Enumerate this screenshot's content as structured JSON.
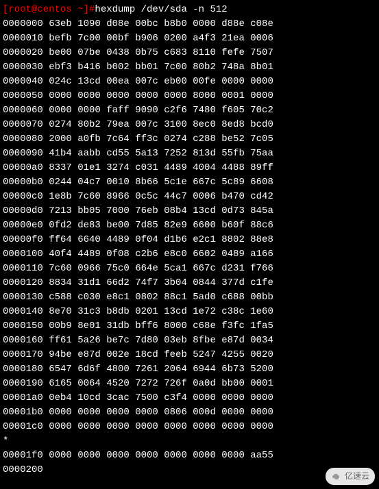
{
  "prompt": {
    "user_host": "[root@centos ~]#",
    "command": "hexdump /dev/sda -n 512"
  },
  "hexdump": {
    "lines": [
      {
        "offset": "0000000",
        "bytes": "63eb 1090 d08e 00bc b8b0 0000 d88e c08e"
      },
      {
        "offset": "0000010",
        "bytes": "befb 7c00 00bf b906 0200 a4f3 21ea 0006"
      },
      {
        "offset": "0000020",
        "bytes": "be00 07be 0438 0b75 c683 8110 fefe 7507"
      },
      {
        "offset": "0000030",
        "bytes": "ebf3 b416 b002 bb01 7c00 80b2 748a 8b01"
      },
      {
        "offset": "0000040",
        "bytes": "024c 13cd 00ea 007c eb00 00fe 0000 0000"
      },
      {
        "offset": "0000050",
        "bytes": "0000 0000 0000 0000 0000 8000 0001 0000"
      },
      {
        "offset": "0000060",
        "bytes": "0000 0000 faff 9090 c2f6 7480 f605 70c2"
      },
      {
        "offset": "0000070",
        "bytes": "0274 80b2 79ea 007c 3100 8ec0 8ed8 bcd0"
      },
      {
        "offset": "0000080",
        "bytes": "2000 a0fb 7c64 ff3c 0274 c288 be52 7c05"
      },
      {
        "offset": "0000090",
        "bytes": "41b4 aabb cd55 5a13 7252 813d 55fb 75aa"
      },
      {
        "offset": "00000a0",
        "bytes": "8337 01e1 3274 c031 4489 4004 4488 89ff"
      },
      {
        "offset": "00000b0",
        "bytes": "0244 04c7 0010 8b66 5c1e 667c 5c89 6608"
      },
      {
        "offset": "00000c0",
        "bytes": "1e8b 7c60 8966 0c5c 44c7 0006 b470 cd42"
      },
      {
        "offset": "00000d0",
        "bytes": "7213 bb05 7000 76eb 08b4 13cd 0d73 845a"
      },
      {
        "offset": "00000e0",
        "bytes": "0fd2 de83 be00 7d85 82e9 6600 b60f 88c6"
      },
      {
        "offset": "00000f0",
        "bytes": "ff64 6640 4489 0f04 d1b6 e2c1 8802 88e8"
      },
      {
        "offset": "0000100",
        "bytes": "40f4 4489 0f08 c2b6 e8c0 6602 0489 a166"
      },
      {
        "offset": "0000110",
        "bytes": "7c60 0966 75c0 664e 5ca1 667c d231 f766"
      },
      {
        "offset": "0000120",
        "bytes": "8834 31d1 66d2 74f7 3b04 0844 377d c1fe"
      },
      {
        "offset": "0000130",
        "bytes": "c588 c030 e8c1 0802 88c1 5ad0 c688 00bb"
      },
      {
        "offset": "0000140",
        "bytes": "8e70 31c3 b8db 0201 13cd 1e72 c38c 1e60"
      },
      {
        "offset": "0000150",
        "bytes": "00b9 8e01 31db bff6 8000 c68e f3fc 1fa5"
      },
      {
        "offset": "0000160",
        "bytes": "ff61 5a26 be7c 7d80 03eb 8fbe e87d 0034"
      },
      {
        "offset": "0000170",
        "bytes": "94be e87d 002e 18cd feeb 5247 4255 0020"
      },
      {
        "offset": "0000180",
        "bytes": "6547 6d6f 4800 7261 2064 6944 6b73 5200"
      },
      {
        "offset": "0000190",
        "bytes": "6165 0064 4520 7272 726f 0a0d bb00 0001"
      },
      {
        "offset": "00001a0",
        "bytes": "0eb4 10cd 3cac 7500 c3f4 0000 0000 0000"
      },
      {
        "offset": "00001b0",
        "bytes": "0000 0000 0000 0000 0806 000d 0000 0000"
      },
      {
        "offset": "00001c0",
        "bytes": "0000 0000 0000 0000 0000 0000 0000 0000"
      }
    ],
    "asterisk": "*",
    "trailing_lines": [
      {
        "offset": "00001f0",
        "bytes": "0000 0000 0000 0000 0000 0000 0000 aa55"
      },
      {
        "offset": "0000200",
        "bytes": ""
      }
    ]
  },
  "watermark": {
    "text": "亿速云"
  }
}
